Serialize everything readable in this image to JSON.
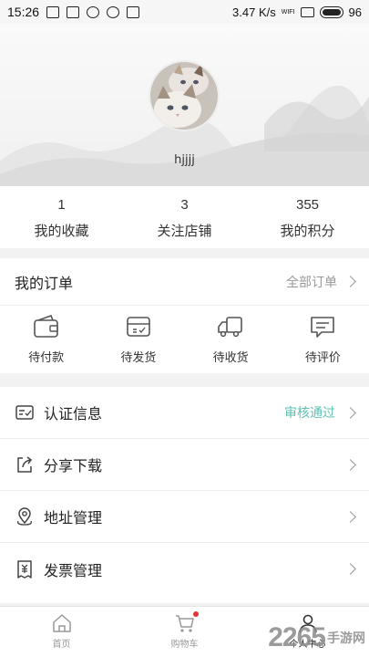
{
  "status_bar": {
    "time": "15:26",
    "speed": "3.47 K/s",
    "wifi_label": "WIFI",
    "battery": "96"
  },
  "profile": {
    "username": "hjjjj"
  },
  "stats": [
    {
      "value": "1",
      "label": "我的收藏"
    },
    {
      "value": "3",
      "label": "关注店铺"
    },
    {
      "value": "355",
      "label": "我的积分"
    }
  ],
  "orders": {
    "title": "我的订单",
    "all_label": "全部订单",
    "items": [
      {
        "label": "待付款",
        "icon": "wallet-icon"
      },
      {
        "label": "待发货",
        "icon": "box-icon"
      },
      {
        "label": "待收货",
        "icon": "truck-icon"
      },
      {
        "label": "待评价",
        "icon": "comment-icon"
      }
    ]
  },
  "menu": [
    {
      "label": "认证信息",
      "status": "审核通过",
      "icon": "id-card-icon"
    },
    {
      "label": "分享下载",
      "icon": "share-icon"
    },
    {
      "label": "地址管理",
      "icon": "location-icon"
    },
    {
      "label": "发票管理",
      "icon": "invoice-icon"
    }
  ],
  "tabs": [
    {
      "label": "首页",
      "icon": "home-icon"
    },
    {
      "label": "购物车",
      "icon": "cart-icon"
    },
    {
      "label": "个人中心",
      "icon": "user-icon"
    }
  ],
  "watermark": {
    "number": "2265",
    "text": "手游网"
  },
  "colors": {
    "accent_teal": "#5cc2b4",
    "badge_red": "#e63232"
  }
}
